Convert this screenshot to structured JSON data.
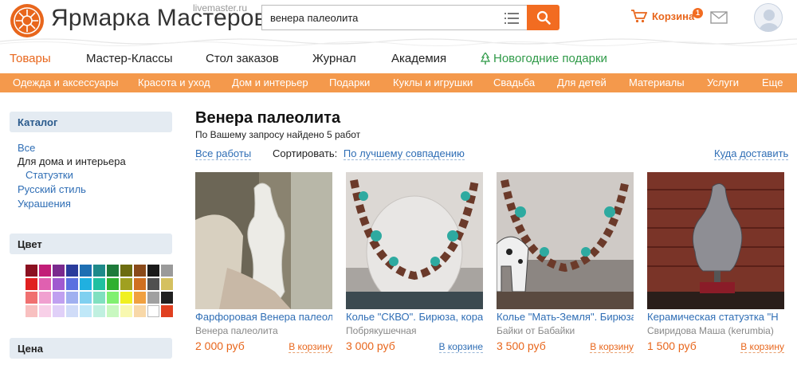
{
  "header": {
    "logo_text": "Ярмарка Мастеров",
    "logo_sub": "livemaster.ru",
    "search_value": "венера палеолита",
    "cart_label": "Корзина",
    "cart_count": "1"
  },
  "main_nav": {
    "items": [
      "Товары",
      "Мастер-Классы",
      "Стол заказов",
      "Журнал",
      "Академия",
      "Новогодние подарки"
    ]
  },
  "categories": [
    "Одежда и аксессуары",
    "Красота и уход",
    "Дом и интерьер",
    "Подарки",
    "Куклы и игрушки",
    "Свадьба",
    "Для детей",
    "Материалы",
    "Услуги",
    "Еще"
  ],
  "sidebar": {
    "catalog_title": "Каталог",
    "catalog_links": [
      "Все",
      "Для дома и интерьера",
      "Статуэтки",
      "Русский стиль",
      "Украшения"
    ],
    "color_title": "Цвет",
    "price_title": "Цена",
    "colors": [
      "#8b1020",
      "#c21e78",
      "#7b2a8e",
      "#2a3c9c",
      "#1e6fb3",
      "#1e8a8a",
      "#1e7a3a",
      "#6d6d10",
      "#8a4a1a",
      "#1a1a1a",
      "#9a9a9a",
      "#e02020",
      "#e060b0",
      "#a05ad0",
      "#5a70e0",
      "#20b0e0",
      "#20c0a0",
      "#30b030",
      "#a0a020",
      "#d07020",
      "#505050",
      "#d4c060",
      "#f07070",
      "#f0a0d0",
      "#c0a0f0",
      "#a0b0f0",
      "#80d0f0",
      "#80e0c0",
      "#80f070",
      "#f0f020",
      "#f0a040",
      "#a0a0a0",
      "#202020",
      "#f8c0c0",
      "#f8d0e8",
      "#e0d0f8",
      "#d0dcf8",
      "#c0e8f8",
      "#c0f0e0",
      "#c8f8c0",
      "#f8f8b0",
      "#f8d8a8",
      "#ffffff",
      "#e04020"
    ]
  },
  "content": {
    "title": "Венера палеолита",
    "results": "По Вашему запросу найдено 5 работ",
    "all_works": "Все работы",
    "sort_label": "Сортировать:",
    "sort_value": "По лучшему совпадению",
    "delivery": "Куда доставить"
  },
  "products": [
    {
      "name": "Фарфоровая Венера палеолита",
      "shop": "Венера палеолита",
      "price": "2 000 руб",
      "action": "В корзину"
    },
    {
      "name": "Колье \"СКВО\". Бирюза, кораллы",
      "shop": "Побрякушечная",
      "price": "3 000 руб",
      "action": "В корзине"
    },
    {
      "name": "Колье \"Мать-Земля\". Бирюза",
      "shop": "Байки от Бабайки",
      "price": "3 500 руб",
      "action": "В корзину"
    },
    {
      "name": "Керамическая статуэтка \"Н",
      "shop": "Свиридова Маша (kerumbia)",
      "price": "1 500 руб",
      "action": "В корзину"
    }
  ]
}
